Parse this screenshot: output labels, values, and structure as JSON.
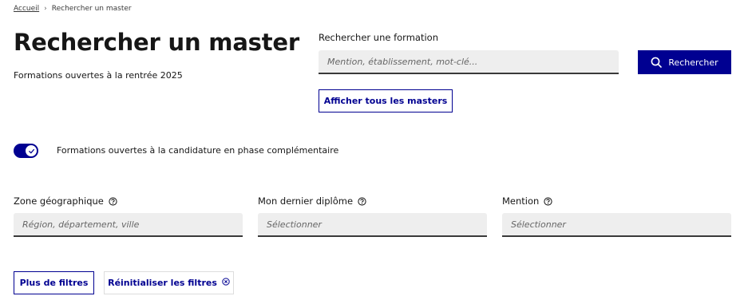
{
  "breadcrumb": {
    "home": "Accueil",
    "separator": "›",
    "current": "Rechercher un master"
  },
  "header": {
    "title": "Rechercher un master",
    "subtitle": "Formations ouvertes à la rentrée 2025"
  },
  "search": {
    "label": "Rechercher une formation",
    "placeholder": "Mention, établissement, mot-clé...",
    "value": "",
    "button_label": "Rechercher",
    "show_all_label": "Afficher tous les masters"
  },
  "toggle": {
    "label": "Formations ouvertes à la candidature en phase complémentaire",
    "checked": true
  },
  "filters": {
    "zone": {
      "label": "Zone géographique",
      "placeholder": "Région, département, ville"
    },
    "diplome": {
      "label": "Mon dernier diplôme",
      "placeholder": "Sélectionner"
    },
    "mention": {
      "label": "Mention",
      "placeholder": "Sélectionner"
    }
  },
  "actions": {
    "more_filters": "Plus de filtres",
    "reset_filters": "Réinitialiser les filtres"
  },
  "colors": {
    "primary": "#000091",
    "input_bg": "#eeeeee",
    "text": "#161616"
  },
  "icons": {
    "search": "search-icon",
    "help": "question-circle-icon",
    "check": "check-icon",
    "close": "close-circle-icon",
    "chevron": "chevron-right-icon"
  }
}
